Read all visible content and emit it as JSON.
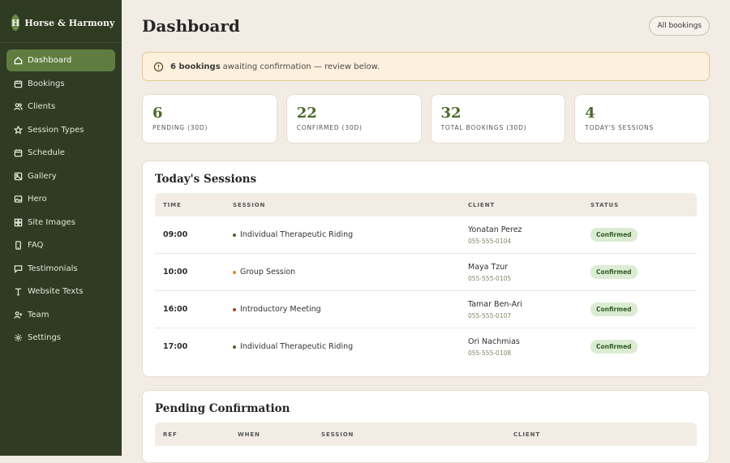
{
  "brand": {
    "initial": "H",
    "name": "Horse & Harmony"
  },
  "sidebar": {
    "items": [
      {
        "label": "Dashboard",
        "icon": "home-icon",
        "active": true
      },
      {
        "label": "Bookings",
        "icon": "calendar-icon"
      },
      {
        "label": "Clients",
        "icon": "users-icon"
      },
      {
        "label": "Session Types",
        "icon": "star-icon"
      },
      {
        "label": "Schedule",
        "icon": "calendar-icon"
      },
      {
        "label": "Gallery",
        "icon": "image-icon"
      },
      {
        "label": "Hero",
        "icon": "image-icon"
      },
      {
        "label": "Site Images",
        "icon": "grid-icon"
      },
      {
        "label": "FAQ",
        "icon": "phone-icon"
      },
      {
        "label": "Testimonials",
        "icon": "message-icon"
      },
      {
        "label": "Website Texts",
        "icon": "text-icon"
      },
      {
        "label": "Team",
        "icon": "user-plus-icon"
      },
      {
        "label": "Settings",
        "icon": "gear-icon"
      }
    ]
  },
  "header": {
    "title": "Dashboard",
    "all_bookings_label": "All bookings"
  },
  "alert": {
    "bold": "6 bookings",
    "text": "awaiting confirmation — review below."
  },
  "stats": [
    {
      "value": "6",
      "label": "PENDING (30D)"
    },
    {
      "value": "22",
      "label": "CONFIRMED (30D)"
    },
    {
      "value": "32",
      "label": "TOTAL BOOKINGS (30D)"
    },
    {
      "value": "4",
      "label": "TODAY'S SESSIONS"
    }
  ],
  "today": {
    "title": "Today's Sessions",
    "columns": [
      "TIME",
      "SESSION",
      "CLIENT",
      "STATUS"
    ],
    "rows": [
      {
        "time": "09:00",
        "session": "Individual Therapeutic Riding",
        "dot_color": "#4c6a2c",
        "client": "Yonatan Perez",
        "phone": "055-555-0104",
        "status": "Confirmed"
      },
      {
        "time": "10:00",
        "session": "Group Session",
        "dot_color": "#d68a3a",
        "client": "Maya Tzur",
        "phone": "055-555-0105",
        "status": "Confirmed"
      },
      {
        "time": "16:00",
        "session": "Introductory Meeting",
        "dot_color": "#a3452e",
        "client": "Tamar Ben-Ari",
        "phone": "055-555-0107",
        "status": "Confirmed"
      },
      {
        "time": "17:00",
        "session": "Individual Therapeutic Riding",
        "dot_color": "#4c6a2c",
        "client": "Ori Nachmias",
        "phone": "055-555-0108",
        "status": "Confirmed"
      }
    ]
  },
  "pending": {
    "title": "Pending Confirmation",
    "columns": [
      "REF",
      "WHEN",
      "SESSION",
      "CLIENT"
    ]
  },
  "colors": {
    "sidebar_bg": "#2f3b23",
    "accent": "#5f7d40",
    "page_bg": "#f2ece5",
    "alert_bg": "#fdf0dc",
    "badge_bg": "#dcecd4"
  }
}
